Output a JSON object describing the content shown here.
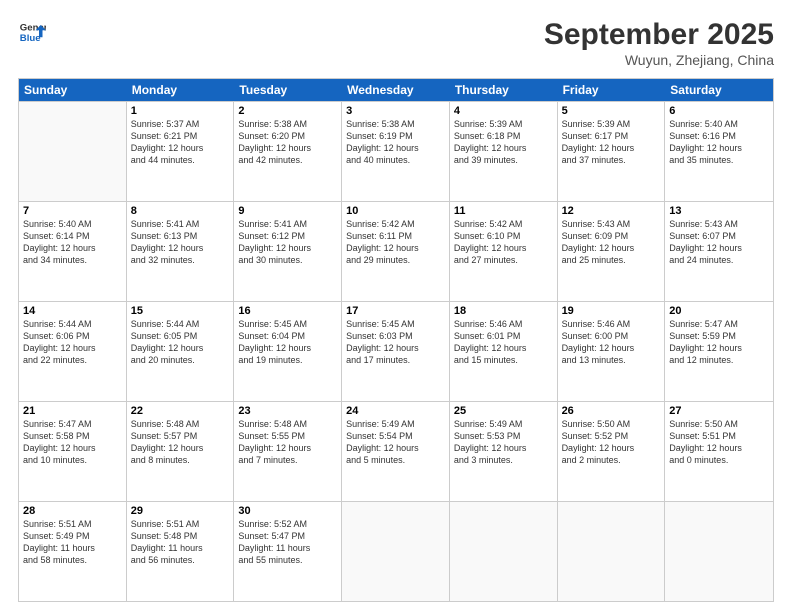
{
  "logo": {
    "line1": "General",
    "line2": "Blue"
  },
  "title": "September 2025",
  "location": "Wuyun, Zhejiang, China",
  "days_header": [
    "Sunday",
    "Monday",
    "Tuesday",
    "Wednesday",
    "Thursday",
    "Friday",
    "Saturday"
  ],
  "weeks": [
    [
      {
        "day": "",
        "info": ""
      },
      {
        "day": "1",
        "info": "Sunrise: 5:37 AM\nSunset: 6:21 PM\nDaylight: 12 hours\nand 44 minutes."
      },
      {
        "day": "2",
        "info": "Sunrise: 5:38 AM\nSunset: 6:20 PM\nDaylight: 12 hours\nand 42 minutes."
      },
      {
        "day": "3",
        "info": "Sunrise: 5:38 AM\nSunset: 6:19 PM\nDaylight: 12 hours\nand 40 minutes."
      },
      {
        "day": "4",
        "info": "Sunrise: 5:39 AM\nSunset: 6:18 PM\nDaylight: 12 hours\nand 39 minutes."
      },
      {
        "day": "5",
        "info": "Sunrise: 5:39 AM\nSunset: 6:17 PM\nDaylight: 12 hours\nand 37 minutes."
      },
      {
        "day": "6",
        "info": "Sunrise: 5:40 AM\nSunset: 6:16 PM\nDaylight: 12 hours\nand 35 minutes."
      }
    ],
    [
      {
        "day": "7",
        "info": "Sunrise: 5:40 AM\nSunset: 6:14 PM\nDaylight: 12 hours\nand 34 minutes."
      },
      {
        "day": "8",
        "info": "Sunrise: 5:41 AM\nSunset: 6:13 PM\nDaylight: 12 hours\nand 32 minutes."
      },
      {
        "day": "9",
        "info": "Sunrise: 5:41 AM\nSunset: 6:12 PM\nDaylight: 12 hours\nand 30 minutes."
      },
      {
        "day": "10",
        "info": "Sunrise: 5:42 AM\nSunset: 6:11 PM\nDaylight: 12 hours\nand 29 minutes."
      },
      {
        "day": "11",
        "info": "Sunrise: 5:42 AM\nSunset: 6:10 PM\nDaylight: 12 hours\nand 27 minutes."
      },
      {
        "day": "12",
        "info": "Sunrise: 5:43 AM\nSunset: 6:09 PM\nDaylight: 12 hours\nand 25 minutes."
      },
      {
        "day": "13",
        "info": "Sunrise: 5:43 AM\nSunset: 6:07 PM\nDaylight: 12 hours\nand 24 minutes."
      }
    ],
    [
      {
        "day": "14",
        "info": "Sunrise: 5:44 AM\nSunset: 6:06 PM\nDaylight: 12 hours\nand 22 minutes."
      },
      {
        "day": "15",
        "info": "Sunrise: 5:44 AM\nSunset: 6:05 PM\nDaylight: 12 hours\nand 20 minutes."
      },
      {
        "day": "16",
        "info": "Sunrise: 5:45 AM\nSunset: 6:04 PM\nDaylight: 12 hours\nand 19 minutes."
      },
      {
        "day": "17",
        "info": "Sunrise: 5:45 AM\nSunset: 6:03 PM\nDaylight: 12 hours\nand 17 minutes."
      },
      {
        "day": "18",
        "info": "Sunrise: 5:46 AM\nSunset: 6:01 PM\nDaylight: 12 hours\nand 15 minutes."
      },
      {
        "day": "19",
        "info": "Sunrise: 5:46 AM\nSunset: 6:00 PM\nDaylight: 12 hours\nand 13 minutes."
      },
      {
        "day": "20",
        "info": "Sunrise: 5:47 AM\nSunset: 5:59 PM\nDaylight: 12 hours\nand 12 minutes."
      }
    ],
    [
      {
        "day": "21",
        "info": "Sunrise: 5:47 AM\nSunset: 5:58 PM\nDaylight: 12 hours\nand 10 minutes."
      },
      {
        "day": "22",
        "info": "Sunrise: 5:48 AM\nSunset: 5:57 PM\nDaylight: 12 hours\nand 8 minutes."
      },
      {
        "day": "23",
        "info": "Sunrise: 5:48 AM\nSunset: 5:55 PM\nDaylight: 12 hours\nand 7 minutes."
      },
      {
        "day": "24",
        "info": "Sunrise: 5:49 AM\nSunset: 5:54 PM\nDaylight: 12 hours\nand 5 minutes."
      },
      {
        "day": "25",
        "info": "Sunrise: 5:49 AM\nSunset: 5:53 PM\nDaylight: 12 hours\nand 3 minutes."
      },
      {
        "day": "26",
        "info": "Sunrise: 5:50 AM\nSunset: 5:52 PM\nDaylight: 12 hours\nand 2 minutes."
      },
      {
        "day": "27",
        "info": "Sunrise: 5:50 AM\nSunset: 5:51 PM\nDaylight: 12 hours\nand 0 minutes."
      }
    ],
    [
      {
        "day": "28",
        "info": "Sunrise: 5:51 AM\nSunset: 5:49 PM\nDaylight: 11 hours\nand 58 minutes."
      },
      {
        "day": "29",
        "info": "Sunrise: 5:51 AM\nSunset: 5:48 PM\nDaylight: 11 hours\nand 56 minutes."
      },
      {
        "day": "30",
        "info": "Sunrise: 5:52 AM\nSunset: 5:47 PM\nDaylight: 11 hours\nand 55 minutes."
      },
      {
        "day": "",
        "info": ""
      },
      {
        "day": "",
        "info": ""
      },
      {
        "day": "",
        "info": ""
      },
      {
        "day": "",
        "info": ""
      }
    ]
  ]
}
